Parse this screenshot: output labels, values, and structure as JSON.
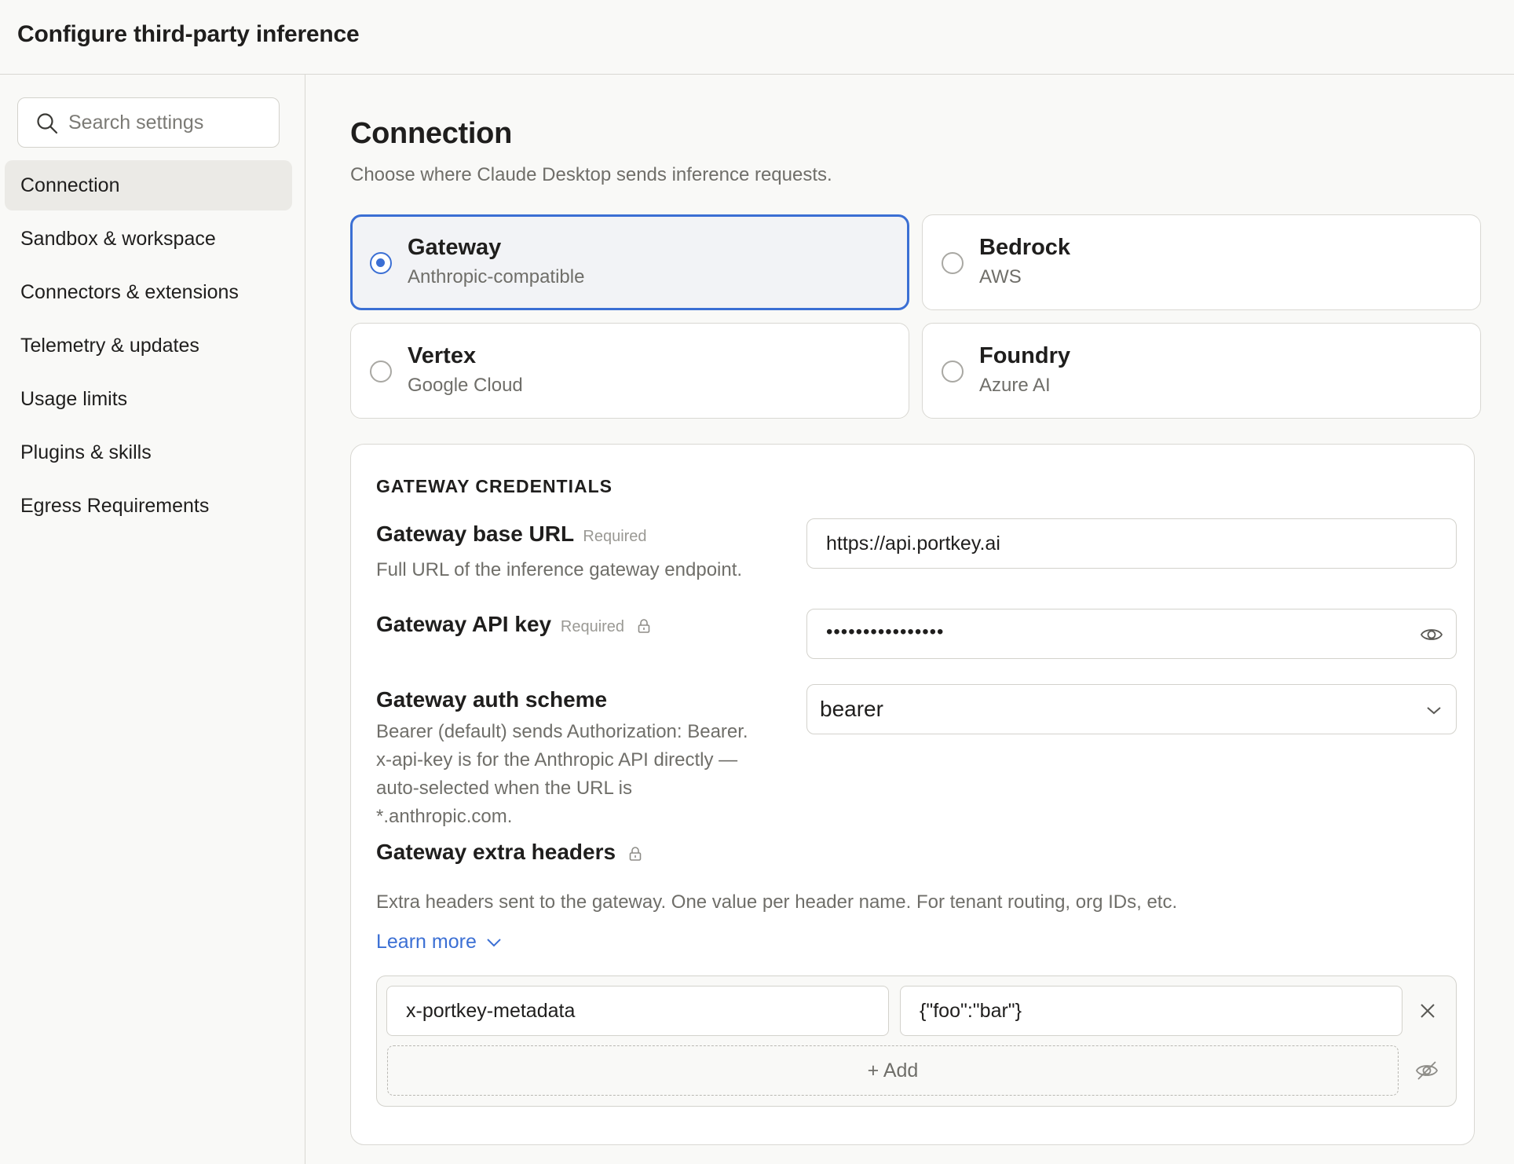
{
  "window": {
    "title": "Configure third-party inference"
  },
  "sidebar": {
    "search_placeholder": "Search settings",
    "items": [
      {
        "label": "Connection",
        "active": true
      },
      {
        "label": "Sandbox & workspace"
      },
      {
        "label": "Connectors & extensions"
      },
      {
        "label": "Telemetry & updates"
      },
      {
        "label": "Usage limits"
      },
      {
        "label": "Plugins & skills"
      },
      {
        "label": "Egress Requirements"
      }
    ]
  },
  "main": {
    "title": "Connection",
    "subtitle": "Choose where Claude Desktop sends inference requests.",
    "options": [
      {
        "name": "Gateway",
        "sub": "Anthropic-compatible",
        "selected": true
      },
      {
        "name": "Bedrock",
        "sub": "AWS"
      },
      {
        "name": "Vertex",
        "sub": "Google Cloud"
      },
      {
        "name": "Foundry",
        "sub": "Azure AI"
      }
    ],
    "credentials": {
      "section_title": "GATEWAY CREDENTIALS",
      "base_url": {
        "label": "Gateway base URL",
        "required": "Required",
        "help": "Full URL of the inference gateway endpoint.",
        "value": "https://api.portkey.ai"
      },
      "api_key": {
        "label": "Gateway API key",
        "required": "Required",
        "masked_value": "••••••••••••••••"
      },
      "auth_scheme": {
        "label": "Gateway auth scheme",
        "help_lines": [
          "Bearer (default) sends Authorization: Bearer.",
          "x-api-key is for the Anthropic API directly —",
          "auto-selected when the URL is",
          "*.anthropic.com."
        ],
        "value": "bearer"
      },
      "extra_headers": {
        "label": "Gateway extra headers",
        "help": "Extra headers sent to the gateway. One value per header name. For tenant routing, org IDs, etc.",
        "learn_more": "Learn more",
        "rows": [
          {
            "name": "x-portkey-metadata",
            "value": "{\"foo\":\"bar\"}"
          }
        ],
        "add_label": "+ Add"
      }
    }
  },
  "colors": {
    "accent": "#3b6fd4",
    "border": "#d9d8d3",
    "muted_text": "#6f6e69"
  }
}
